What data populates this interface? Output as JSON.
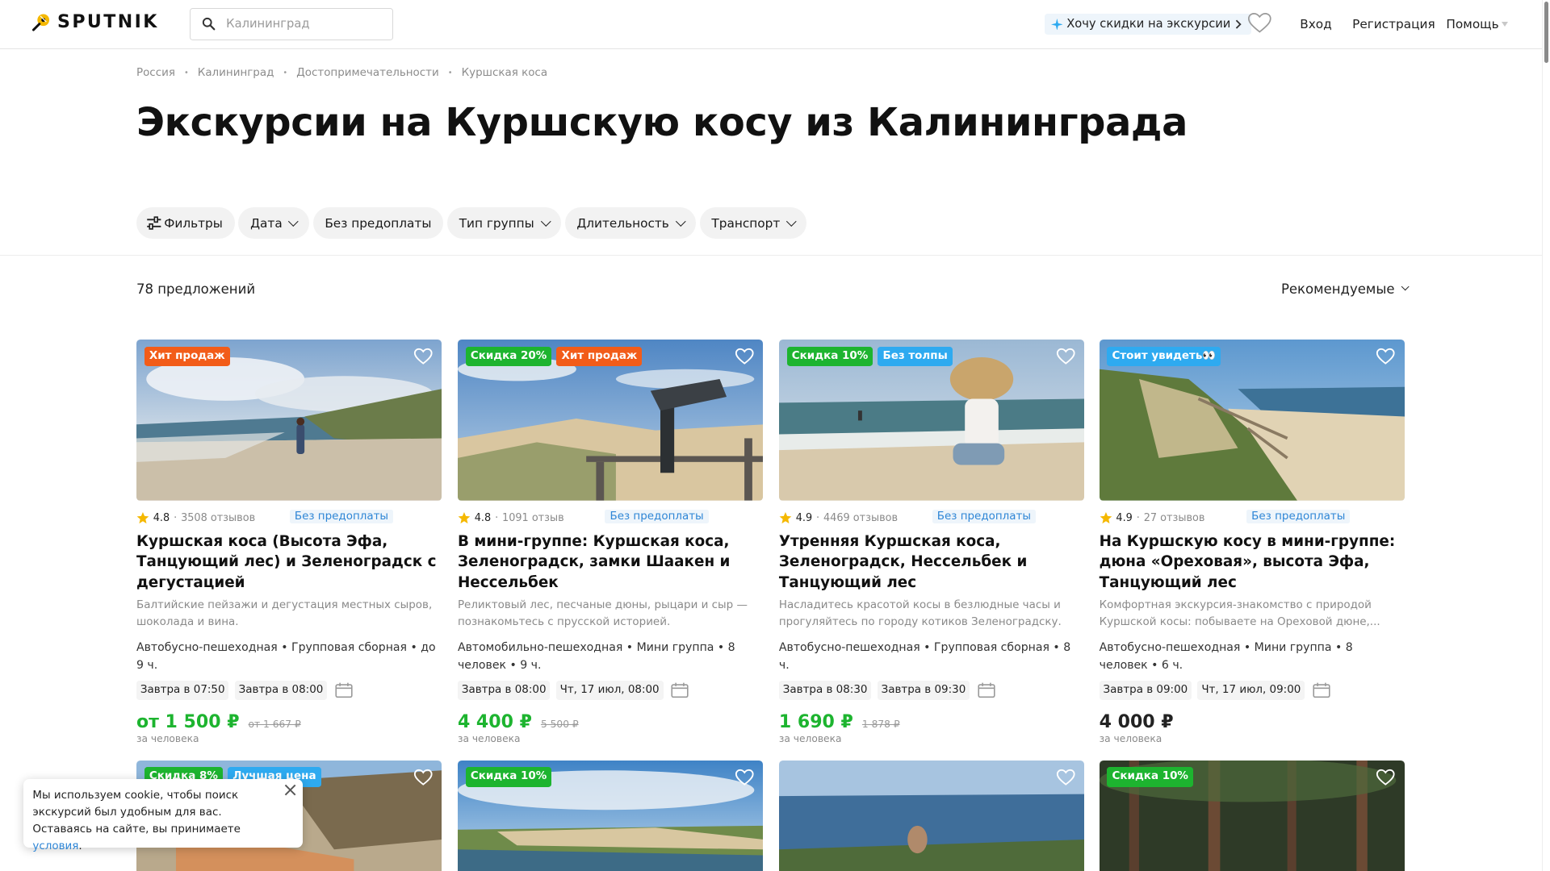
{
  "header": {
    "logo": "SPUTNIK",
    "search_placeholder": "Калининград",
    "promo": "Хочу скидки на экскурсии",
    "login": "Вход",
    "register": "Регистрация",
    "help": "Помощь"
  },
  "breadcrumbs": [
    "Россия",
    "Калининград",
    "Достопримечательности",
    "Куршская коса"
  ],
  "title": "Экскурсии на Куршскую косу из Калининграда",
  "filters": [
    "Фильтры",
    "Дата",
    "Без предоплаты",
    "Тип группы",
    "Длительность",
    "Транспорт"
  ],
  "results": {
    "count": "78 предложений",
    "sort": "Рекомендуемые"
  },
  "colors": {
    "green_badge": "#1db42f",
    "orange_badge": "#f25c19",
    "blue_badge": "#2eaaf0",
    "price_green": "#1db42f",
    "star": "#f5b800"
  },
  "cards": [
    {
      "badges": [
        {
          "text": "Хит продаж",
          "color": "#f25c19"
        }
      ],
      "rating": "4.8",
      "reviews": "3508 отзывов",
      "prepay": "Без предоплаты",
      "title": "Куршская коса (Высота Эфа, Танцующий лес) и Зеленоградск с дегустацией",
      "desc": "Балтийские пейзажи и дегустация местных сыров, шоколада и вина.",
      "info": "Автобусно-пешеходная • Групповая сборная • до 9 ч.",
      "times": [
        "Завтра в 07:50",
        "Завтра в 08:00"
      ],
      "price": "от 1 500 ₽",
      "old_price": "от 1 667 ₽",
      "per": "за человека",
      "price_color": "#1db42f"
    },
    {
      "badges": [
        {
          "text": "Скидка 20%",
          "color": "#1db42f"
        },
        {
          "text": "Хит продаж",
          "color": "#f25c19"
        }
      ],
      "rating": "4.8",
      "reviews": "1091 отзыв",
      "prepay": "Без предоплаты",
      "title": "В мини-группе: Куршская коса, Зеленоградск, замки Шаакен и Нессельбек",
      "desc": "Реликтовый лес, песчаные дюны, рыцари и сыр — познакомьтесь с прусской историей.",
      "info": "Автомобильно-пешеходная • Мини группа • 8 человек • 9 ч.",
      "times": [
        "Завтра в 08:00",
        "Чт, 17 июл, 08:00"
      ],
      "price": "4 400 ₽",
      "old_price": "5 500 ₽",
      "per": "за человека",
      "price_color": "#1db42f"
    },
    {
      "badges": [
        {
          "text": "Скидка 10%",
          "color": "#1db42f"
        },
        {
          "text": "Без толпы",
          "color": "#2eaaf0"
        }
      ],
      "rating": "4.9",
      "reviews": "4469 отзывов",
      "prepay": "Без предоплаты",
      "title": "Утренняя Куршская коса, Зеленоградск, Нессельбек и Танцующий лес",
      "desc": "Насладитесь красотой косы в безлюдные часы и прогуляйтесь по городу котиков Зеленоградску.",
      "info": "Автобусно-пешеходная • Групповая сборная • 8 ч.",
      "times": [
        "Завтра в 08:30",
        "Завтра в 09:30"
      ],
      "price": "1 690 ₽",
      "old_price": "1 878 ₽",
      "per": "за человека",
      "price_color": "#1db42f"
    },
    {
      "badges": [
        {
          "text": "Стоит увидеть👀",
          "color": "#2eaaf0"
        }
      ],
      "rating": "4.9",
      "reviews": "27 отзывов",
      "prepay": "Без предоплаты",
      "title": "На Куршскую косу в мини-группе: дюна «Ореховая», высота Эфа, Танцующий лес",
      "desc": "Комфортная экскурсия-знакомство с природой Куршской косы: побываете на Ореховой дюне,...",
      "info": "Автобусно-пешеходная • Мини группа • 8 человек • 6 ч.",
      "times": [
        "Завтра в 09:00",
        "Чт, 17 июл, 09:00"
      ],
      "price": "4 000 ₽",
      "old_price": "",
      "per": "за человека",
      "price_color": "#222222"
    }
  ],
  "second_row_badges": [
    [
      {
        "text": "Скидка 8%",
        "color": "#1db42f"
      },
      {
        "text": "Лучшая цена",
        "color": "#2eaaf0"
      }
    ],
    [
      {
        "text": "Скидка 10%",
        "color": "#1db42f"
      }
    ],
    [],
    [
      {
        "text": "Скидка 10%",
        "color": "#1db42f"
      }
    ]
  ],
  "cookie": {
    "text": "Мы используем cookie, чтобы поиск экскурсий был удобным для вас. Оставаясь на сайте, вы принимаете ",
    "link": "условия",
    "end": "."
  }
}
